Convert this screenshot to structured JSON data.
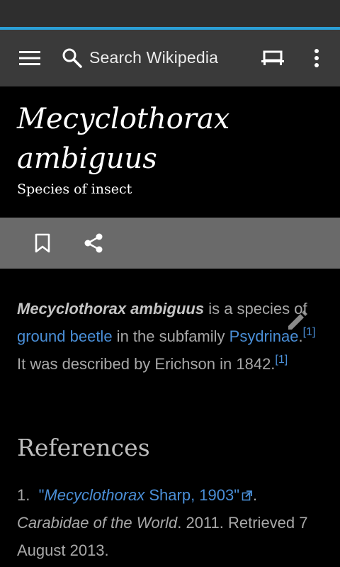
{
  "toolbar": {
    "search_placeholder": "Search Wikipedia",
    "icons": [
      "menu-icon",
      "search-icon",
      "reading-lists-icon",
      "overflow-icon"
    ]
  },
  "article": {
    "title": "Mecyclothorax ambiguus",
    "description": "Species of insect",
    "actions": [
      "bookmark-icon",
      "share-icon"
    ],
    "lead": {
      "bold": "Mecyclothorax ambiguus",
      "t1": " is a species of ",
      "link1": "ground beetle",
      "t2": " in the subfamily ",
      "link2": "Psydrinae",
      "t3": ".",
      "ref1": "[1]",
      "t4": " It was described by Erichson in 1842.",
      "ref2": "[1]"
    }
  },
  "references": {
    "heading": "References",
    "items": [
      {
        "number": "1.",
        "link_prefix": "\"",
        "link_italic": "Mecyclothorax",
        "link_rest": " Sharp, 1903\"",
        "after_link": ".",
        "publication": "Carabidae of the World",
        "rest": ". 2011. Retrieved 7 August 2013."
      }
    ]
  },
  "colors": {
    "progress": "#2b9fd6",
    "link": "#4a8fd8",
    "toolbar": "#3a3a3a",
    "action_bar": "#6a6a6a",
    "background": "#000000"
  }
}
